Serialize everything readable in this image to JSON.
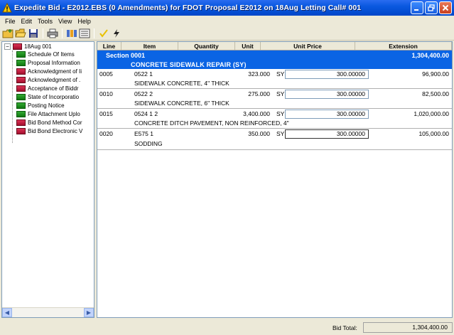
{
  "window": {
    "title": "Expedite Bid - E2012.EBS (0 Amendments) for FDOT Proposal E2012 on 18Aug Letting Call# 001",
    "minimize": "minimize",
    "maximize": "maximize",
    "close": "close"
  },
  "menu": [
    "File",
    "Edit",
    "Tools",
    "View",
    "Help"
  ],
  "toolbar": {
    "icons": [
      "new-icon",
      "open-icon",
      "save-icon",
      "print-icon",
      "columns-icon",
      "list-icon",
      "check-icon",
      "lightning-icon"
    ]
  },
  "tree": {
    "root": "18Aug 001",
    "items": [
      {
        "label": "Schedule Of Items",
        "color": "green"
      },
      {
        "label": "Proposal Information",
        "color": "green"
      },
      {
        "label": "Acknowledgment of Ii",
        "color": "red"
      },
      {
        "label": "Acknowledgment of .",
        "color": "red"
      },
      {
        "label": "Acceptance of Biddr",
        "color": "red"
      },
      {
        "label": "State of Incorporatio",
        "color": "green"
      },
      {
        "label": "Posting Notice",
        "color": "green"
      },
      {
        "label": "File Attachment Uplo",
        "color": "green"
      },
      {
        "label": "Bid Bond Method Cor",
        "color": "red"
      },
      {
        "label": "Bid Bond Electronic V",
        "color": "red"
      }
    ]
  },
  "grid": {
    "columns": [
      "Line",
      "Item",
      "Quantity",
      "Unit",
      "Unit Price",
      "Extension"
    ],
    "section": {
      "label": "Section 0001",
      "extension": "1,304,400.00",
      "description": "CONCRETE SIDEWALK REPAIR (SY)"
    },
    "rows": [
      {
        "line": "0005",
        "item": "0522 1",
        "quantity": "323.000",
        "unit": "SY",
        "unit_price": "300.00000",
        "extension": "96,900.00",
        "description": "SIDEWALK CONCRETE, 4\" THICK"
      },
      {
        "line": "0010",
        "item": "0522 2",
        "quantity": "275.000",
        "unit": "SY",
        "unit_price": "300.00000",
        "extension": "82,500.00",
        "description": "SIDEWALK CONCRETE, 6\" THICK"
      },
      {
        "line": "0015",
        "item": "0524 1 2",
        "quantity": "3,400.000",
        "unit": "SY",
        "unit_price": "300.00000",
        "extension": "1,020,000.00",
        "description": "CONCRETE DITCH PAVEMENT, NON REINFORCED, 4\""
      },
      {
        "line": "0020",
        "item": "E575 1",
        "quantity": "350.000",
        "unit": "SY",
        "unit_price": "300.00000",
        "extension": "105,000.00",
        "description": "SODDING"
      }
    ]
  },
  "status": {
    "bid_total_label": "Bid Total:",
    "bid_total": "1,304,400.00"
  },
  "colors": {
    "titlebar": "#0a58e0",
    "section_row": "#0a64e4",
    "green_book": "#22992a",
    "red_book": "#c8203f"
  }
}
